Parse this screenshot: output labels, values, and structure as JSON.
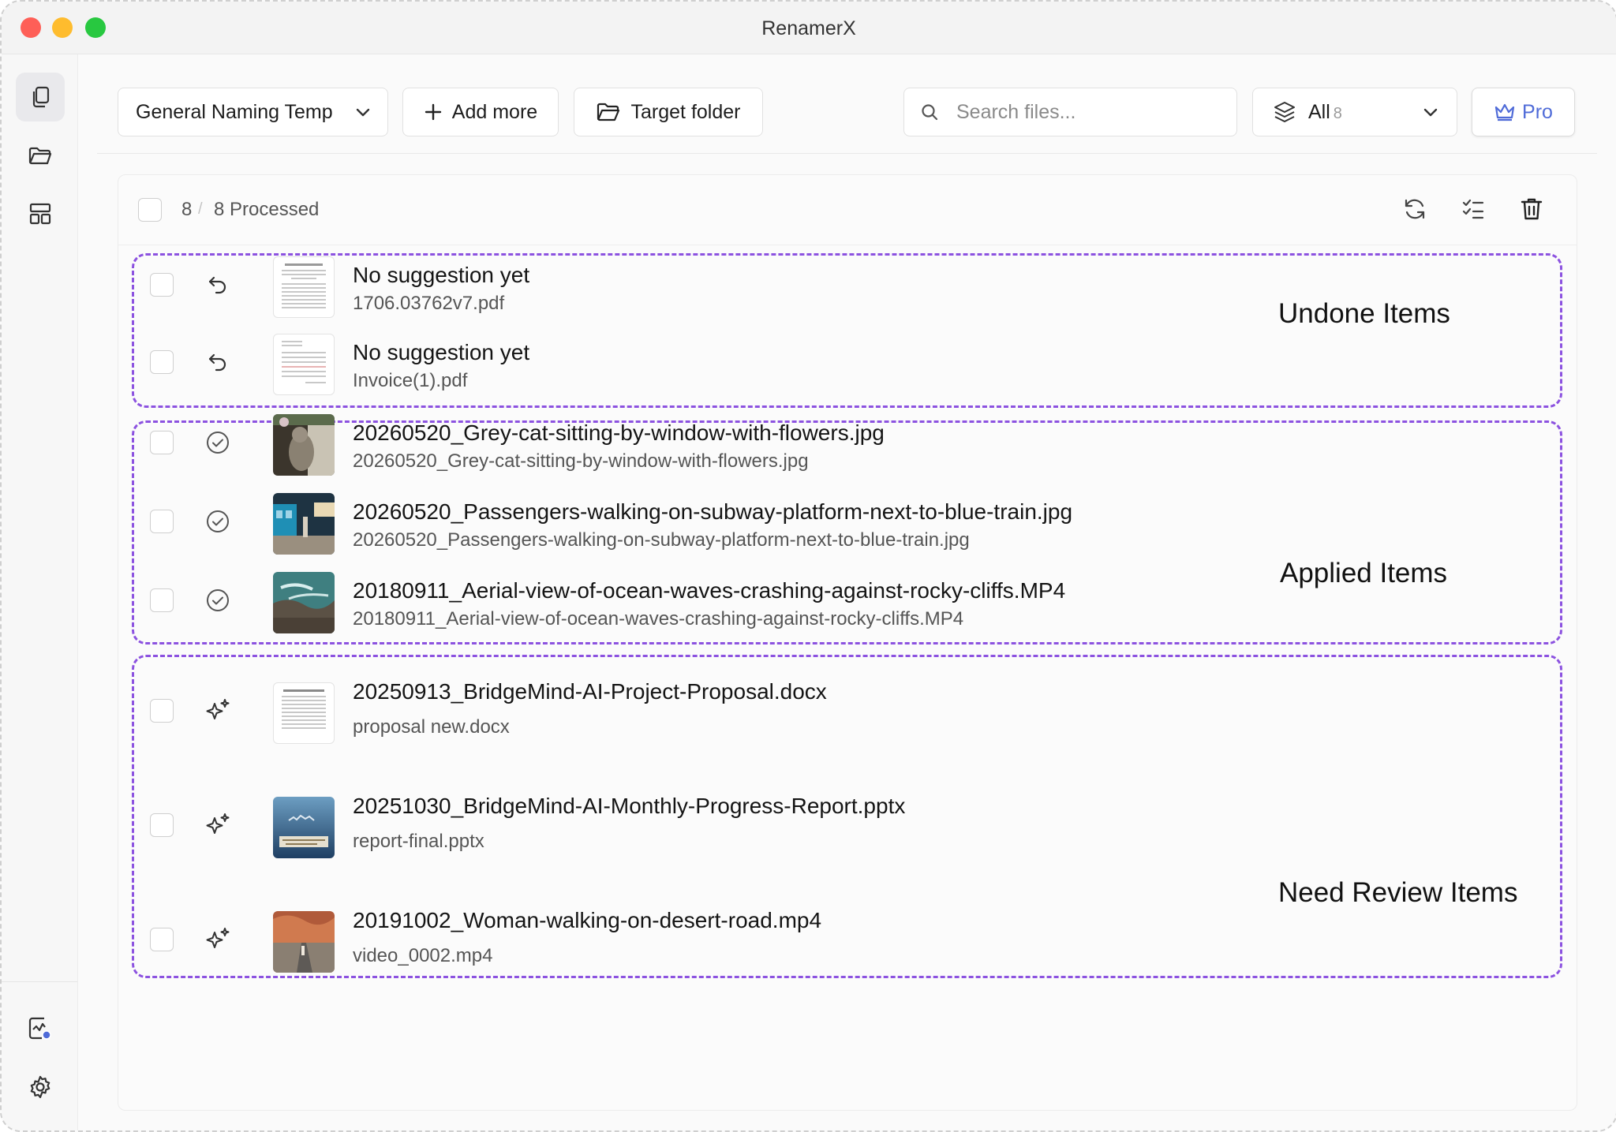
{
  "window": {
    "title": "RenamerX"
  },
  "toolbar": {
    "template_label": "General Naming Temp",
    "add_more_label": "Add more",
    "target_folder_label": "Target folder",
    "search_placeholder": "Search files...",
    "filter_label": "All",
    "filter_count": "8",
    "pro_label": "Pro"
  },
  "list_header": {
    "selected_count": "8",
    "separator": "/",
    "processed_text": "8 Processed"
  },
  "groups": [
    {
      "label": "Undone Items"
    },
    {
      "label": "Applied Items"
    },
    {
      "label": "Need Review Items"
    }
  ],
  "files": [
    {
      "new_name": "No suggestion yet",
      "original_name": "1706.03762v7.pdf",
      "status": "undone",
      "thumb": "pdf-document"
    },
    {
      "new_name": "No suggestion yet",
      "original_name": "Invoice(1).pdf",
      "status": "undone",
      "thumb": "pdf-invoice"
    },
    {
      "new_name": "20260520_Grey-cat-sitting-by-window-with-flowers.jpg",
      "original_name": "20260520_Grey-cat-sitting-by-window-with-flowers.jpg",
      "status": "applied",
      "thumb": "photo-cat"
    },
    {
      "new_name": "20260520_Passengers-walking-on-subway-platform-next-to-blue-train.jpg",
      "original_name": "20260520_Passengers-walking-on-subway-platform-next-to-blue-train.jpg",
      "status": "applied",
      "thumb": "photo-subway"
    },
    {
      "new_name": "20180911_Aerial-view-of-ocean-waves-crashing-against-rocky-cliffs.MP4",
      "original_name": "20180911_Aerial-view-of-ocean-waves-crashing-against-rocky-cliffs.MP4",
      "status": "applied",
      "thumb": "video-ocean"
    },
    {
      "new_name": "20250913_BridgeMind-AI-Project-Proposal.docx",
      "original_name": "proposal new.docx",
      "status": "review",
      "thumb": "docx-document"
    },
    {
      "new_name": "20251030_BridgeMind-AI-Monthly-Progress-Report.pptx",
      "original_name": "report-final.pptx",
      "status": "review",
      "thumb": "pptx-slide"
    },
    {
      "new_name": "20191002_Woman-walking-on-desert-road.mp4",
      "original_name": "video_0002.mp4",
      "status": "review",
      "thumb": "video-desert"
    }
  ],
  "icons": {
    "sidebar_top": [
      "files-icon",
      "folder-icon",
      "layout-icon"
    ],
    "sidebar_bottom": [
      "activity-icon",
      "settings-icon"
    ],
    "header_actions": [
      "refresh-icon",
      "checklist-icon",
      "trash-icon"
    ],
    "status": {
      "undone": "undo-icon",
      "applied": "check-circle-icon",
      "review": "sparkle-icon"
    }
  },
  "colors": {
    "group_border": "#8c52e0",
    "pro_accent": "#4f6bd8",
    "notification_dot": "#4f6bd8"
  }
}
